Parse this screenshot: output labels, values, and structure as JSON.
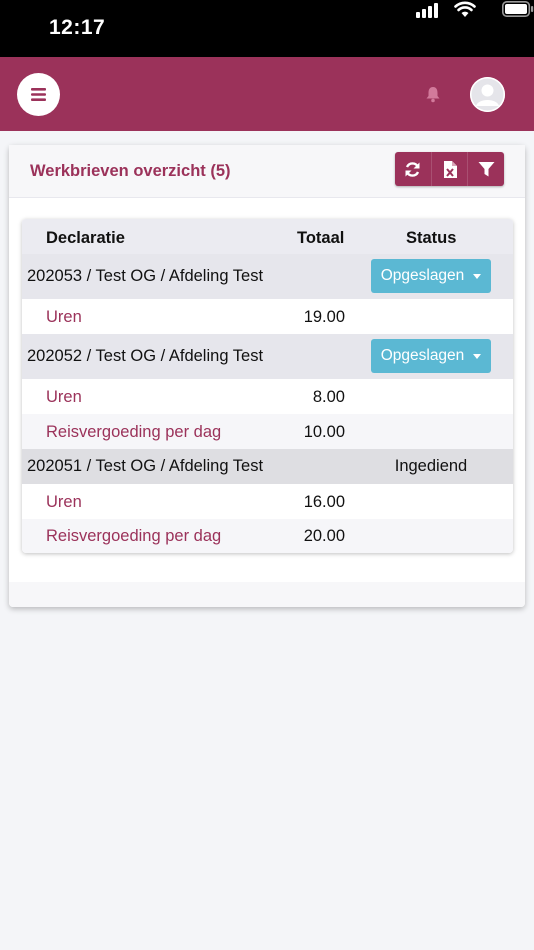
{
  "status_bar": {
    "time": "12:17"
  },
  "header": {
    "menu_icon": "hamburger-icon",
    "bell_icon": "bell-icon",
    "avatar_icon": "user-avatar-icon"
  },
  "colors": {
    "primary": "#9b325a",
    "status_button": "#5bb8d3",
    "group_row": "#e6e6ec"
  },
  "card": {
    "title": "Werkbrieven overzicht (5)",
    "toolbar": [
      {
        "icon": "refresh-icon",
        "name": "refresh-button"
      },
      {
        "icon": "excel-export-icon",
        "name": "export-excel-button"
      },
      {
        "icon": "filter-icon",
        "name": "filter-button"
      }
    ]
  },
  "table": {
    "headers": {
      "declaratie": "Declaratie",
      "totaal": "Totaal",
      "status": "Status"
    },
    "groups": [
      {
        "title": "202053 / Test OG / Afdeling Test",
        "status": "Opgeslagen",
        "status_type": "dropdown",
        "items": [
          {
            "label": "Uren",
            "total": "19.00"
          }
        ]
      },
      {
        "title": "202052 / Test OG / Afdeling Test",
        "status": "Opgeslagen",
        "status_type": "dropdown",
        "items": [
          {
            "label": "Uren",
            "total": "8.00"
          },
          {
            "label": "Reisvergoeding per dag",
            "total": "10.00"
          }
        ]
      },
      {
        "title": "202051 / Test OG / Afdeling Test",
        "status": "Ingediend",
        "status_type": "text",
        "items": [
          {
            "label": "Uren",
            "total": "16.00"
          },
          {
            "label": "Reisvergoeding per dag",
            "total": "20.00"
          }
        ]
      }
    ]
  }
}
